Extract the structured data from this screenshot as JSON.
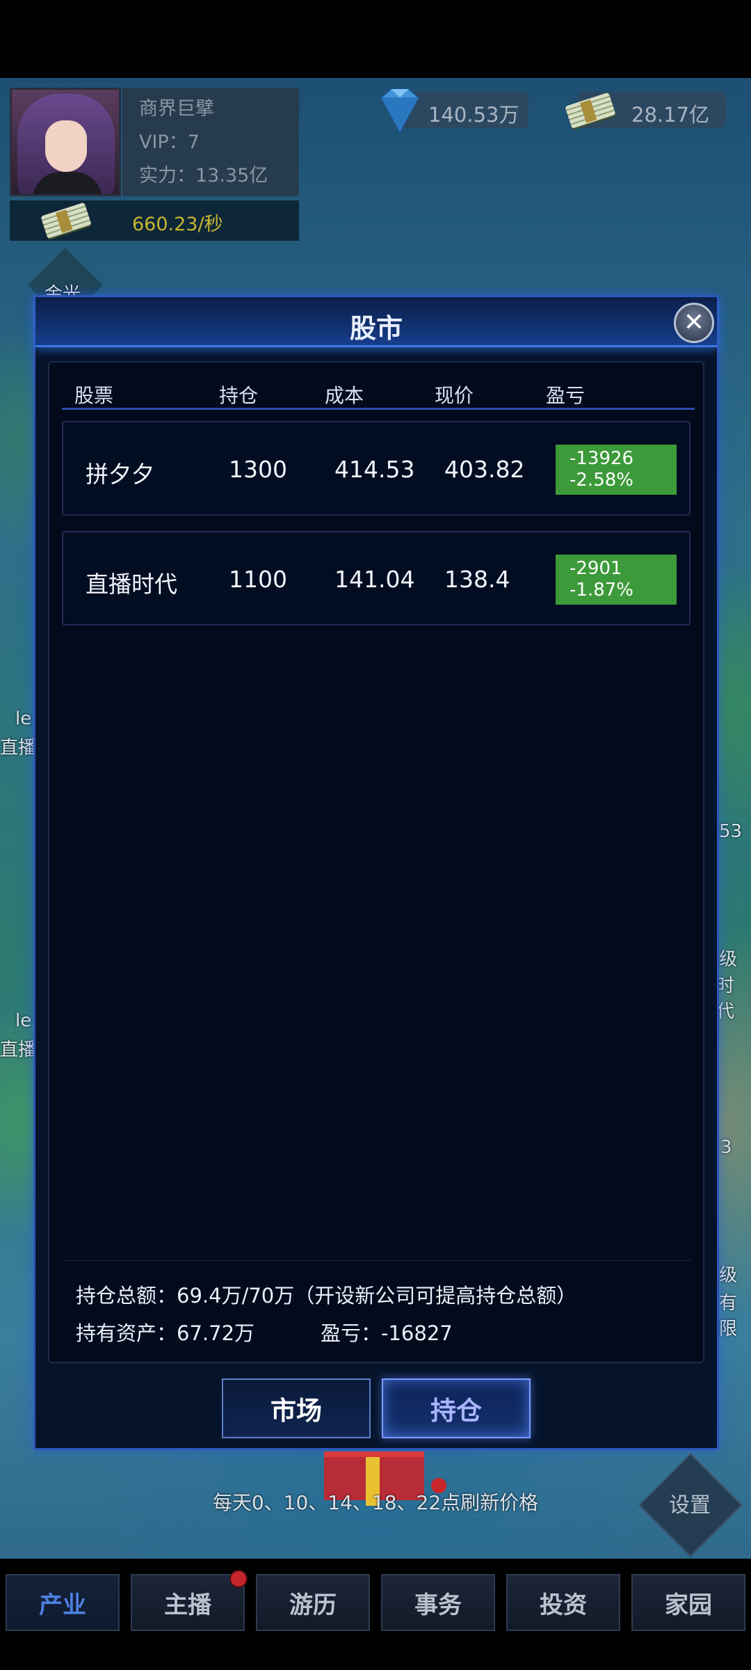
{
  "player": {
    "title": "商界巨擘",
    "vip": "VIP：7",
    "power": "实力：13.35亿",
    "income_rate": "660.23/秒"
  },
  "resources": {
    "diamonds": "140.53万",
    "cash": "28.17亿"
  },
  "background_labels": {
    "left_1": "le",
    "left_2": "直播",
    "left_3": "le",
    "left_4": "直播",
    "right_1": "53",
    "right_2": "级",
    "right_3": "时代",
    "right_4": "3",
    "right_5": "级",
    "right_6": "有限",
    "top_partial": "金光"
  },
  "modal": {
    "title": "股市",
    "columns": [
      "股票",
      "持仓",
      "成本",
      "现价",
      "盈亏"
    ],
    "rows": [
      {
        "stock": "拼夕夕",
        "holding": "1300",
        "cost": "414.53",
        "price": "403.82",
        "pl_amount": "-13926",
        "pl_percent": "-2.58%"
      },
      {
        "stock": "直播时代",
        "holding": "1100",
        "cost": "141.04",
        "price": "138.4",
        "pl_amount": "-2901",
        "pl_percent": "-1.87%"
      }
    ],
    "summary_total": "持仓总额：69.4万/70万（开设新公司可提高持仓总额）",
    "summary_assets": "持有资产：67.72万",
    "summary_pl": "盈亏：-16827",
    "tab_market": "市场",
    "tab_holdings": "持仓",
    "active_tab": "持仓"
  },
  "refresh_note": "每天0、10、14、18、22点刷新价格",
  "settings_label": "设置",
  "nav": {
    "items": [
      "产业",
      "主播",
      "游历",
      "事务",
      "投资",
      "家园"
    ],
    "active": "产业"
  },
  "colors": {
    "loss_badge": "#3d9a3a",
    "accent_blue": "#2c56b8",
    "income_gold": "#c8b531"
  }
}
